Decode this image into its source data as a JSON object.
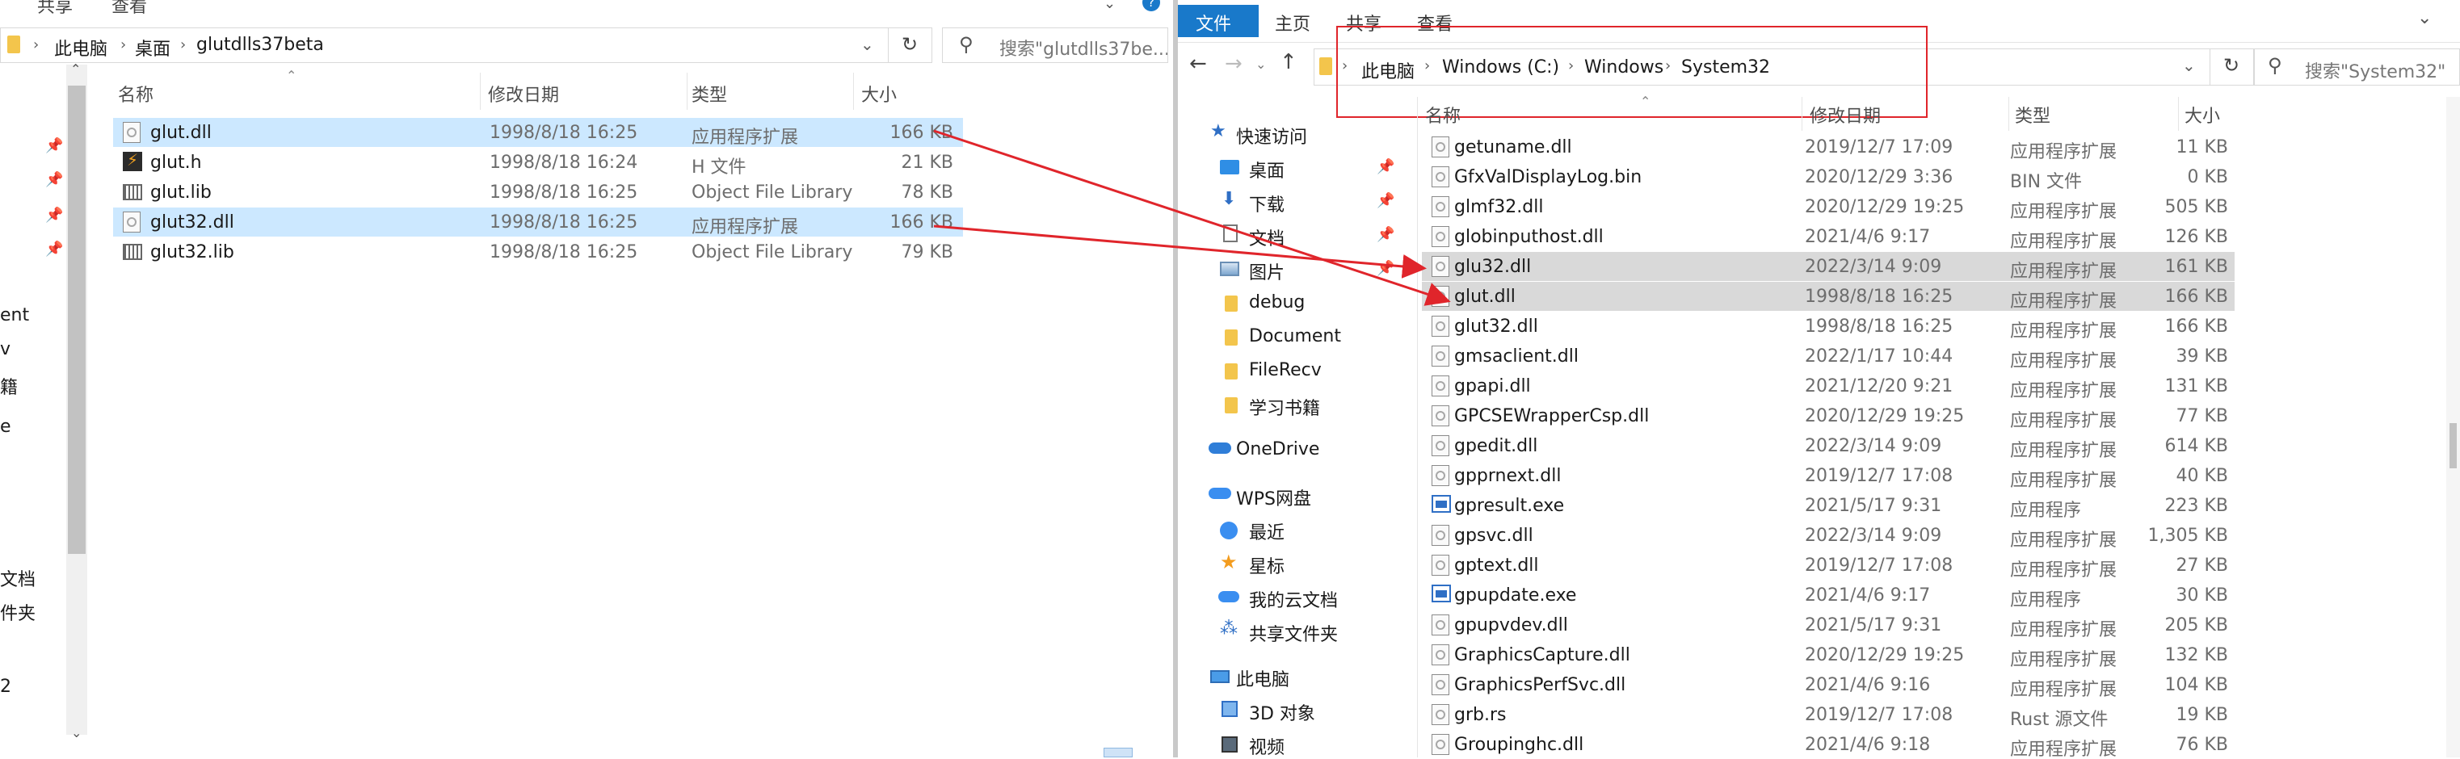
{
  "left": {
    "ribbon": [
      "共享",
      "查看"
    ],
    "breadcrumb": [
      "此电脑",
      "桌面",
      "glutdlls37beta"
    ],
    "search_placeholder": "搜索\"glutdlls37be...",
    "columns": {
      "name": "名称",
      "date": "修改日期",
      "type": "类型",
      "size": "大小"
    },
    "files": [
      {
        "name": "glut.dll",
        "date": "1998/8/18 16:25",
        "type": "应用程序扩展",
        "size": "166 KB",
        "icon": "dll-icon",
        "selected": true
      },
      {
        "name": "glut.h",
        "date": "1998/8/18 16:24",
        "type": "H 文件",
        "size": "21 KB",
        "icon": "header-file-icon",
        "selected": false
      },
      {
        "name": "glut.lib",
        "date": "1998/8/18 16:25",
        "type": "Object File Library",
        "size": "78 KB",
        "icon": "lib-icon",
        "selected": false
      },
      {
        "name": "glut32.dll",
        "date": "1998/8/18 16:25",
        "type": "应用程序扩展",
        "size": "166 KB",
        "icon": "dll-icon",
        "selected": true
      },
      {
        "name": "glut32.lib",
        "date": "1998/8/18 16:25",
        "type": "Object File Library",
        "size": "79 KB",
        "icon": "lib-icon",
        "selected": false
      }
    ],
    "nav_fragments": [
      "ent",
      "v",
      "籍",
      "e",
      "文档",
      "件夹",
      "2"
    ]
  },
  "right": {
    "ribbon": [
      "文件",
      "主页",
      "共享",
      "查看"
    ],
    "breadcrumb": [
      "此电脑",
      "Windows (C:)",
      "Windows",
      "System32"
    ],
    "search_placeholder": "搜索\"System32\"",
    "columns": {
      "name": "名称",
      "date": "修改日期",
      "type": "类型",
      "size": "大小"
    },
    "nav": [
      {
        "label": "快速访问",
        "icon": "star-icon"
      },
      {
        "label": "桌面",
        "icon": "desktop-icon"
      },
      {
        "label": "下载",
        "icon": "download-icon"
      },
      {
        "label": "文档",
        "icon": "document-icon"
      },
      {
        "label": "图片",
        "icon": "picture-icon"
      },
      {
        "label": "debug",
        "icon": "folder-icon"
      },
      {
        "label": "Document",
        "icon": "folder-icon"
      },
      {
        "label": "FileRecv",
        "icon": "folder-icon"
      },
      {
        "label": "学习书籍",
        "icon": "folder-icon"
      },
      {
        "label": "OneDrive",
        "icon": "cloud-icon"
      },
      {
        "label": "WPS网盘",
        "icon": "cloud-icon"
      },
      {
        "label": "最近",
        "icon": "clock-icon"
      },
      {
        "label": "星标",
        "icon": "star-icon"
      },
      {
        "label": "我的云文档",
        "icon": "cloud-doc-icon"
      },
      {
        "label": "共享文件夹",
        "icon": "share-icon"
      },
      {
        "label": "此电脑",
        "icon": "computer-icon"
      },
      {
        "label": "3D 对象",
        "icon": "cube-icon"
      },
      {
        "label": "视频",
        "icon": "video-icon"
      }
    ],
    "files": [
      {
        "name": "getuname.dll",
        "date": "2019/12/7 17:09",
        "type": "应用程序扩展",
        "size": "11 KB",
        "icon": "dll-icon"
      },
      {
        "name": "GfxValDisplayLog.bin",
        "date": "2020/12/29 3:36",
        "type": "BIN 文件",
        "size": "0 KB",
        "icon": "file-icon"
      },
      {
        "name": "glmf32.dll",
        "date": "2020/12/29 19:25",
        "type": "应用程序扩展",
        "size": "505 KB",
        "icon": "dll-icon"
      },
      {
        "name": "globinputhost.dll",
        "date": "2021/4/6 9:17",
        "type": "应用程序扩展",
        "size": "126 KB",
        "icon": "dll-icon"
      },
      {
        "name": "glu32.dll",
        "date": "2022/3/14 9:09",
        "type": "应用程序扩展",
        "size": "161 KB",
        "icon": "dll-icon",
        "highlight": true
      },
      {
        "name": "glut.dll",
        "date": "1998/8/18 16:25",
        "type": "应用程序扩展",
        "size": "166 KB",
        "icon": "dll-icon",
        "highlight": true
      },
      {
        "name": "glut32.dll",
        "date": "1998/8/18 16:25",
        "type": "应用程序扩展",
        "size": "166 KB",
        "icon": "dll-icon"
      },
      {
        "name": "gmsaclient.dll",
        "date": "2022/1/17 10:44",
        "type": "应用程序扩展",
        "size": "39 KB",
        "icon": "dll-icon"
      },
      {
        "name": "gpapi.dll",
        "date": "2021/12/20 9:21",
        "type": "应用程序扩展",
        "size": "131 KB",
        "icon": "dll-icon"
      },
      {
        "name": "GPCSEWrapperCsp.dll",
        "date": "2020/12/29 19:25",
        "type": "应用程序扩展",
        "size": "77 KB",
        "icon": "dll-icon"
      },
      {
        "name": "gpedit.dll",
        "date": "2022/3/14 9:09",
        "type": "应用程序扩展",
        "size": "614 KB",
        "icon": "dll-icon"
      },
      {
        "name": "gpprnext.dll",
        "date": "2019/12/7 17:08",
        "type": "应用程序扩展",
        "size": "40 KB",
        "icon": "dll-icon"
      },
      {
        "name": "gpresult.exe",
        "date": "2021/5/17 9:31",
        "type": "应用程序",
        "size": "223 KB",
        "icon": "exe-icon"
      },
      {
        "name": "gpsvc.dll",
        "date": "2022/3/14 9:09",
        "type": "应用程序扩展",
        "size": "1,305 KB",
        "icon": "dll-icon"
      },
      {
        "name": "gptext.dll",
        "date": "2019/12/7 17:08",
        "type": "应用程序扩展",
        "size": "27 KB",
        "icon": "dll-icon"
      },
      {
        "name": "gpupdate.exe",
        "date": "2021/4/6 9:17",
        "type": "应用程序",
        "size": "30 KB",
        "icon": "exe-icon"
      },
      {
        "name": "gpupvdev.dll",
        "date": "2021/5/17 9:31",
        "type": "应用程序扩展",
        "size": "205 KB",
        "icon": "dll-icon"
      },
      {
        "name": "GraphicsCapture.dll",
        "date": "2020/12/29 19:25",
        "type": "应用程序扩展",
        "size": "132 KB",
        "icon": "dll-icon"
      },
      {
        "name": "GraphicsPerfSvc.dll",
        "date": "2021/4/6 9:16",
        "type": "应用程序扩展",
        "size": "104 KB",
        "icon": "dll-icon"
      },
      {
        "name": "grb.rs",
        "date": "2019/12/7 17:08",
        "type": "Rust 源文件",
        "size": "19 KB",
        "icon": "file-icon"
      },
      {
        "name": "Groupinghc.dll",
        "date": "2021/4/6 9:18",
        "type": "应用程序扩展",
        "size": "76 KB",
        "icon": "dll-icon"
      }
    ]
  },
  "colors": {
    "ribbon_file": "#1979ca",
    "selection": "#cce8ff",
    "highlight_row": "#d9d9d9",
    "annotation": "#e0252b"
  }
}
